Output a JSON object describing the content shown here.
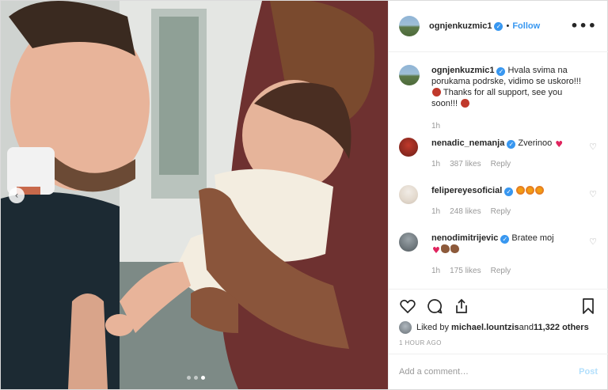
{
  "post": {
    "username": "ognjenkuzmic1",
    "follow_label": "Follow",
    "bullet": "•",
    "more_label": "•••",
    "carousel_prev": "‹"
  },
  "caption": {
    "username": "ognjenkuzmic1",
    "text": " Hvala svima na porukama podrske, vidimo se uskoro!!! ",
    "text2": " Thanks for all support, see you soon!!! ",
    "time": "1h"
  },
  "comments": [
    {
      "username": "nenadic_nemanja",
      "text": " Zverinoo ",
      "time": "1h",
      "likes": "387 likes",
      "reply": "Reply"
    },
    {
      "username": "felipereyesoficial",
      "text": " ",
      "time": "1h",
      "likes": "248 likes",
      "reply": "Reply"
    },
    {
      "username": "nenodimitrijevic",
      "text": " Bratee moj",
      "time": "1h",
      "likes": "175 likes",
      "reply": "Reply"
    }
  ],
  "likes": {
    "prefix": "Liked by ",
    "user": "michael.lountzis",
    "middle": " and ",
    "count": "11,322 others"
  },
  "time_ago": "1 HOUR AGO",
  "add_comment": {
    "placeholder": "Add a comment…",
    "post_label": "Post"
  },
  "colors": {
    "accent": "#3897f0",
    "verified": "#3897f0",
    "muted": "#999999",
    "post_disabled": "#b2dffc"
  },
  "icons": [
    "verified-badge-icon",
    "heart-icon",
    "comment-icon",
    "share-icon",
    "bookmark-icon",
    "more-icon",
    "carousel-prev-icon"
  ]
}
